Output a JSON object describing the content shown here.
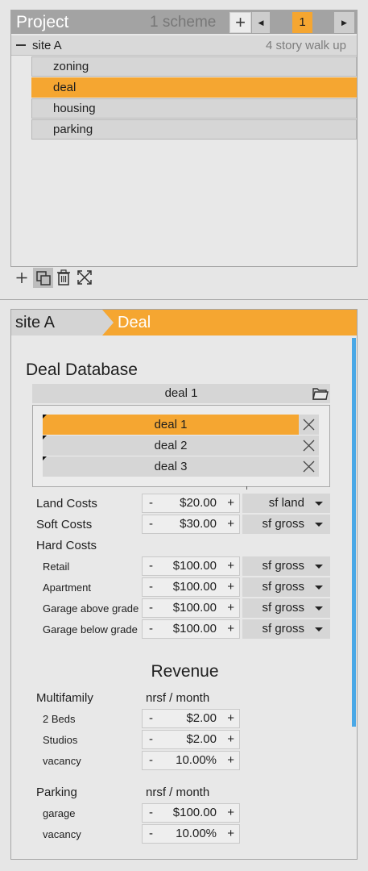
{
  "project": {
    "title": "Project",
    "scheme_count": "1 scheme",
    "add_label": "+",
    "prev_label": "◀",
    "page": "1",
    "next_label": "▶",
    "site": {
      "name": "site A",
      "building_type": "4 story walk up",
      "items": [
        {
          "label": "zoning",
          "active": false
        },
        {
          "label": "deal",
          "active": true
        },
        {
          "label": "housing",
          "active": false
        },
        {
          "label": "parking",
          "active": false
        }
      ]
    },
    "toolbar_icons": [
      "plus-icon",
      "duplicate-icon",
      "trash-icon",
      "expand-icon"
    ]
  },
  "breadcrumb": {
    "site": "site A",
    "page": "Deal"
  },
  "deal_database": {
    "title": "Deal Database",
    "selected": "deal 1",
    "deals": [
      {
        "name": "deal 1",
        "active": true
      },
      {
        "name": "deal 2",
        "active": false
      },
      {
        "name": "deal 3",
        "active": false
      }
    ]
  },
  "costs": {
    "land": {
      "label": "Land Costs",
      "minus": "-",
      "value": "$20.00",
      "plus": "+",
      "unit": "sf land"
    },
    "soft": {
      "label": "Soft Costs",
      "minus": "-",
      "value": "$30.00",
      "plus": "+",
      "unit": "sf gross"
    },
    "hard_label": "Hard Costs",
    "hard": [
      {
        "label": "Retail",
        "value": "$100.00",
        "unit": "sf gross"
      },
      {
        "label": "Apartment",
        "value": "$100.00",
        "unit": "sf gross"
      },
      {
        "label": "Garage above grade",
        "value": "$100.00",
        "unit": "sf gross"
      },
      {
        "label": "Garage below grade",
        "value": "$100.00",
        "unit": "sf gross"
      }
    ]
  },
  "revenue": {
    "title": "Revenue",
    "multifamily": {
      "label": "Multifamily",
      "unit": "nrsf / month",
      "rows": [
        {
          "label": "2 Beds",
          "value": "$2.00"
        },
        {
          "label": "Studios",
          "value": "$2.00"
        },
        {
          "label": "vacancy",
          "value": "10.00%"
        }
      ]
    },
    "parking": {
      "label": "Parking",
      "unit": "nrsf / month",
      "rows": [
        {
          "label": "garage",
          "value": "$100.00"
        },
        {
          "label": "vacancy",
          "value": "10.00%"
        }
      ]
    }
  },
  "stepper_minus": "-",
  "stepper_plus": "+",
  "colors": {
    "accent": "#f5a631",
    "scrollbar": "#4aa8e6",
    "header_gray": "#a3a3a3",
    "panel": "#e6e6e6"
  }
}
